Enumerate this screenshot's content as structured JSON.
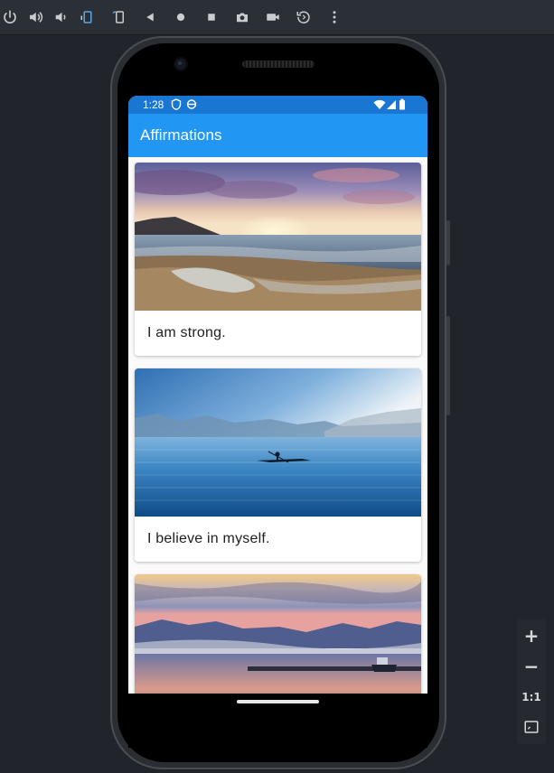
{
  "toolbar": {
    "buttons": [
      {
        "name": "power-icon"
      },
      {
        "name": "volume-up-icon"
      },
      {
        "name": "volume-down-icon"
      },
      {
        "name": "rotate-left-icon"
      },
      {
        "name": "rotate-right-icon"
      },
      {
        "name": "back-icon"
      },
      {
        "name": "home-icon"
      },
      {
        "name": "overview-icon"
      },
      {
        "name": "camera-icon"
      },
      {
        "name": "video-icon"
      },
      {
        "name": "replay-icon"
      },
      {
        "name": "more-icon"
      }
    ]
  },
  "zoom_panel": {
    "zoom_in": "+",
    "zoom_out": "−",
    "actual_size": "1:1"
  },
  "status_bar": {
    "time": "1:28"
  },
  "app_bar": {
    "title": "Affirmations"
  },
  "affirmations": [
    {
      "text": "I am strong.",
      "image": "beach-sunset"
    },
    {
      "text": "I believe in myself.",
      "image": "lake-kayak"
    },
    {
      "text": "",
      "image": "lake-dusk-dock"
    }
  ],
  "colors": {
    "status_bar": "#1976d2",
    "app_bar": "#2196f3",
    "emulator_bg": "#21252b"
  }
}
